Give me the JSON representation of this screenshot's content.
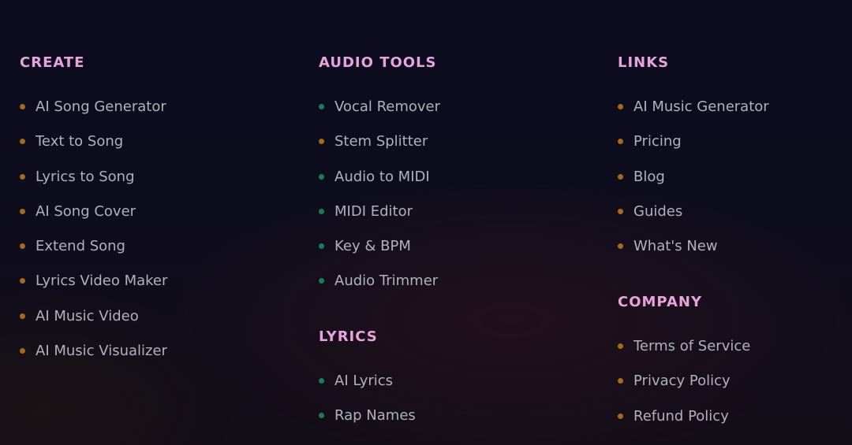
{
  "theme": {
    "heading_color": "#e7a3dc",
    "text_color": "#b1b1bd",
    "dot_orange": "#a36a22",
    "dot_green": "#1d7a5e"
  },
  "create": {
    "title": "CREATE",
    "items": [
      {
        "label": "AI Song Generator",
        "dot": "orange"
      },
      {
        "label": "Text to Song",
        "dot": "orange"
      },
      {
        "label": "Lyrics to Song",
        "dot": "orange"
      },
      {
        "label": "AI Song Cover",
        "dot": "orange"
      },
      {
        "label": "Extend Song",
        "dot": "orange"
      },
      {
        "label": "Lyrics Video Maker",
        "dot": "orange"
      },
      {
        "label": "AI Music Video",
        "dot": "orange"
      },
      {
        "label": "AI Music Visualizer",
        "dot": "orange"
      }
    ]
  },
  "audio_tools": {
    "title": "AUDIO TOOLS",
    "items": [
      {
        "label": "Vocal Remover",
        "dot": "green"
      },
      {
        "label": "Stem Splitter",
        "dot": "orange"
      },
      {
        "label": "Audio to MIDI",
        "dot": "green"
      },
      {
        "label": "MIDI Editor",
        "dot": "green"
      },
      {
        "label": "Key & BPM",
        "dot": "green"
      },
      {
        "label": "Audio Trimmer",
        "dot": "green"
      }
    ]
  },
  "lyrics": {
    "title": "LYRICS",
    "items": [
      {
        "label": "AI Lyrics",
        "dot": "green"
      },
      {
        "label": "Rap Names",
        "dot": "green"
      }
    ]
  },
  "links": {
    "title": "LINKS",
    "items": [
      {
        "label": "AI Music Generator",
        "dot": "orange"
      },
      {
        "label": "Pricing",
        "dot": "orange"
      },
      {
        "label": "Blog",
        "dot": "orange"
      },
      {
        "label": "Guides",
        "dot": "orange"
      },
      {
        "label": "What's New",
        "dot": "orange"
      }
    ]
  },
  "company": {
    "title": "COMPANY",
    "items": [
      {
        "label": "Terms of Service",
        "dot": "orange"
      },
      {
        "label": "Privacy Policy",
        "dot": "orange"
      },
      {
        "label": "Refund Policy",
        "dot": "orange"
      }
    ]
  }
}
